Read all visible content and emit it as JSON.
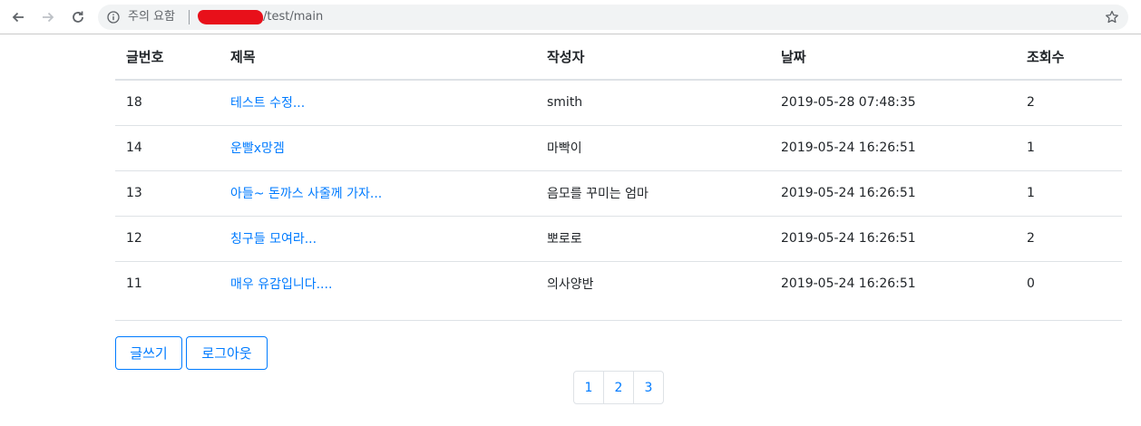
{
  "browser": {
    "security_label": "주의 요함",
    "url_path": "/test/main",
    "icons": {
      "back": "back-arrow-icon",
      "forward": "forward-arrow-icon",
      "reload": "reload-icon",
      "info": "info-icon",
      "bookmark": "star-icon"
    }
  },
  "table": {
    "headers": {
      "no": "글번호",
      "title": "제목",
      "author": "작성자",
      "date": "날짜",
      "views": "조회수"
    },
    "rows": [
      {
        "no": "18",
        "title": "테스트 수정...",
        "author": "smith",
        "date": "2019-05-28 07:48:35",
        "views": "2"
      },
      {
        "no": "14",
        "title": "운빨x망겜",
        "author": "마빡이",
        "date": "2019-05-24 16:26:51",
        "views": "1"
      },
      {
        "no": "13",
        "title": "아들~ 돈까스 사줄께 가자...",
        "author": "음모를 꾸미는 엄마",
        "date": "2019-05-24 16:26:51",
        "views": "1"
      },
      {
        "no": "12",
        "title": "칭구들 모여라...",
        "author": "뽀로로",
        "date": "2019-05-24 16:26:51",
        "views": "2"
      },
      {
        "no": "11",
        "title": "매우 유감입니다....",
        "author": "의사양반",
        "date": "2019-05-24 16:26:51",
        "views": "0"
      }
    ]
  },
  "actions": {
    "write_label": "글쓰기",
    "logout_label": "로그아웃"
  },
  "pagination": {
    "pages": [
      "1",
      "2",
      "3"
    ]
  },
  "colors": {
    "link": "#007bff",
    "border": "#dee2e6",
    "redaction": "#e8101a"
  }
}
